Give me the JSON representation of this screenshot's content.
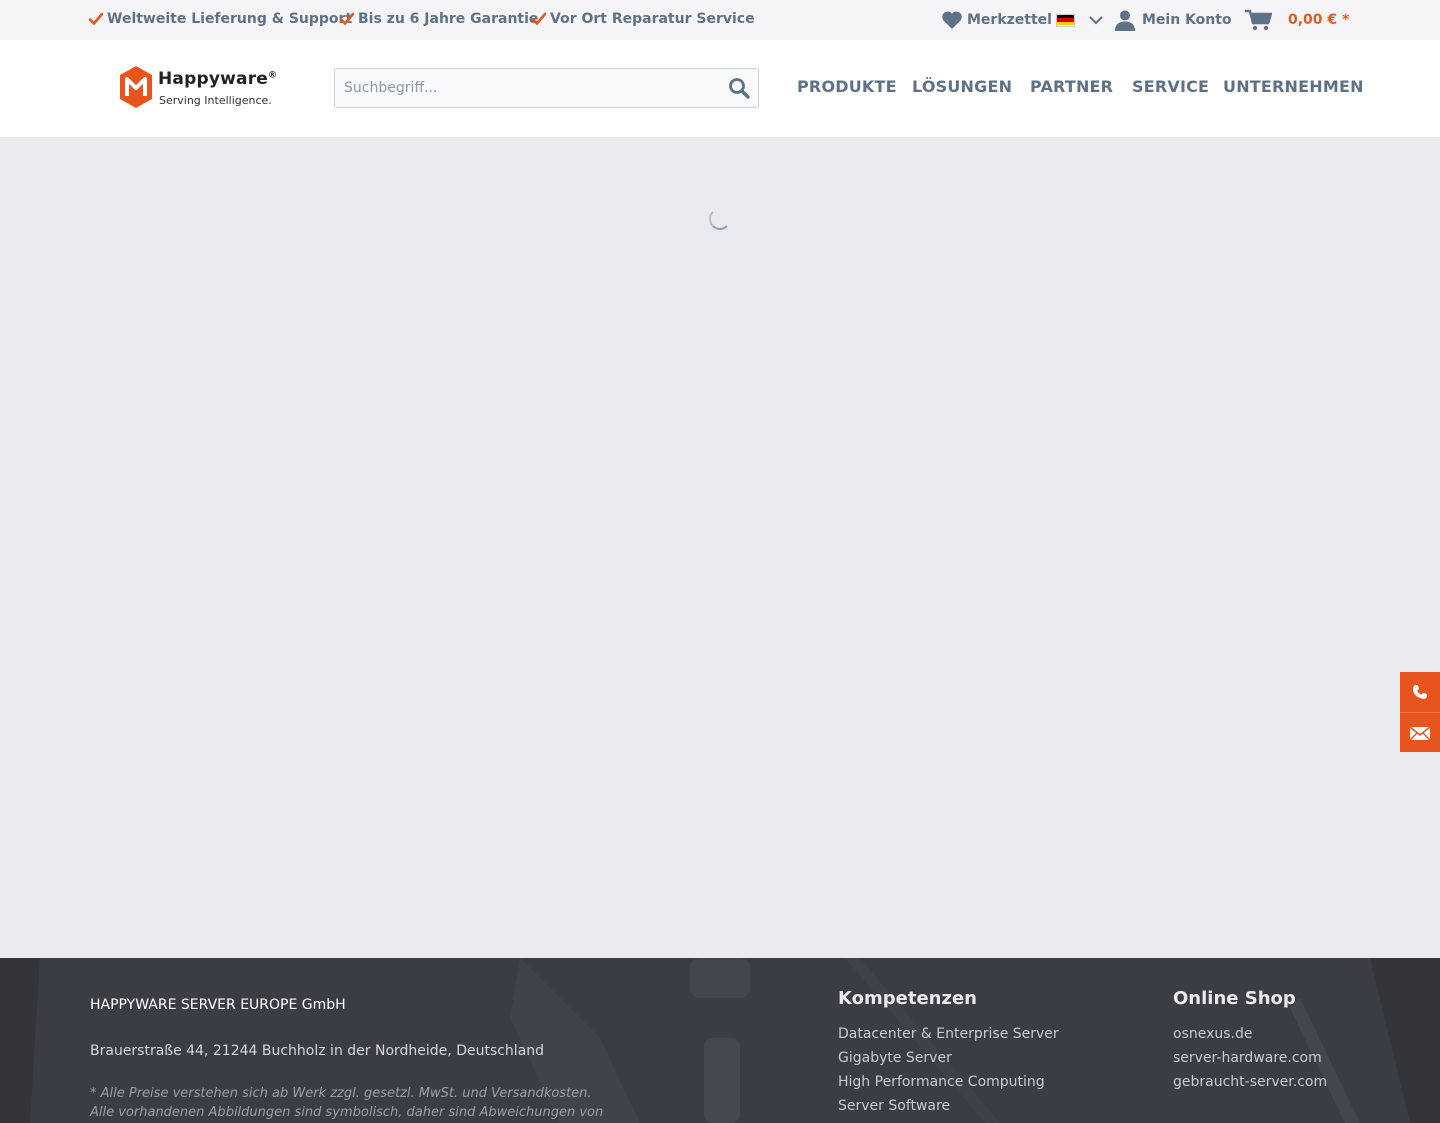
{
  "colors": {
    "accent": "#e8541e",
    "price": "#e05d21",
    "text": "#5f7285",
    "footer_bg": "#3b3d44",
    "main_bg": "#e9ebee"
  },
  "topbar": {
    "usps": [
      {
        "icon": "check-icon",
        "label": "Weltweite Lieferung & Support"
      },
      {
        "icon": "check-icon",
        "label": "Bis zu 6 Jahre Garantie"
      },
      {
        "icon": "check-icon",
        "label": "Vor Ort Reparatur Service"
      }
    ],
    "wishlist_label": "Merkzettel",
    "language": {
      "icon": "germany-flag-icon",
      "selected": "Deutsch"
    },
    "account_label": "Mein Konto",
    "cart_total": "0,00 € *"
  },
  "header": {
    "logo": {
      "name": "Happyware",
      "registered": "®",
      "tagline": "Serving Intelligence."
    },
    "search": {
      "placeholder": "Suchbegriff...",
      "value": ""
    },
    "nav": [
      "PRODUKTE",
      "LÖSUNGEN",
      "PARTNER",
      "SERVICE",
      "UNTERNEHMEN"
    ]
  },
  "main": {
    "loading": true
  },
  "side_buttons": [
    {
      "icon": "phone-icon"
    },
    {
      "icon": "mail-icon"
    }
  ],
  "footer": {
    "company": "HAPPYWARE SERVER EUROPE GmbH",
    "address": "Brauerstraße 44, 21244 Buchholz in der Nordheide, Deutschland",
    "note": "* Alle Preise verstehen sich ab Werk zzgl. gesetzl. MwSt. und Versandkosten. Alle vorhandenen Abbildungen sind symbolisch, daher sind Abweichungen von dem",
    "columns": [
      {
        "title": "Kompetenzen",
        "links": [
          "Datacenter & Enterprise Server",
          "Gigabyte Server",
          "High Performance Computing",
          "Server Software"
        ]
      },
      {
        "title": "Online Shop",
        "links": [
          "osnexus.de",
          "server-hardware.com",
          "gebraucht-server.com"
        ]
      }
    ]
  }
}
